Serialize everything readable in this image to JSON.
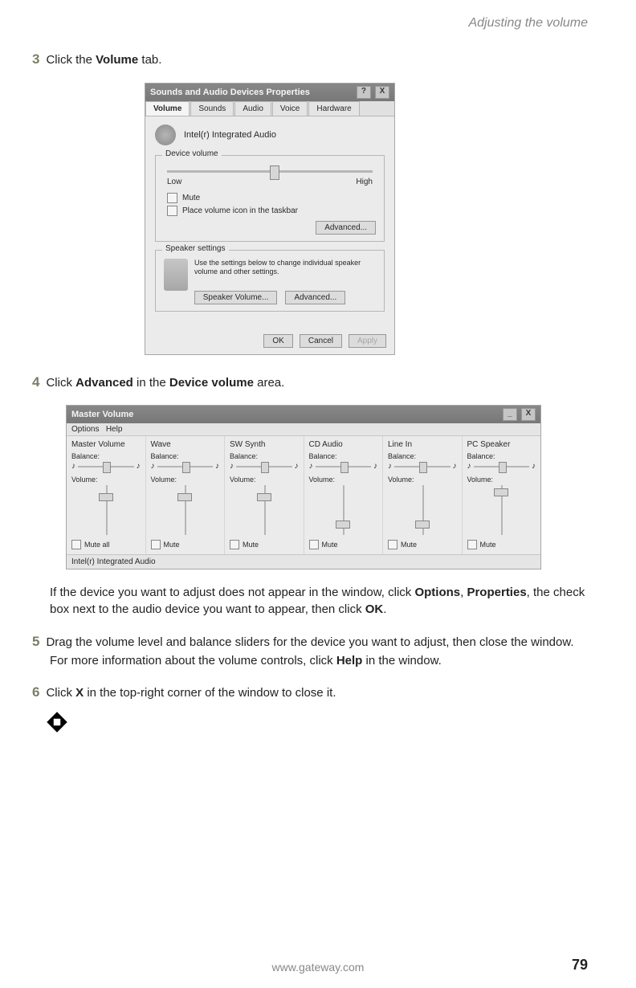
{
  "header": {
    "section_title": "Adjusting the volume"
  },
  "steps": {
    "s3": {
      "num": "3",
      "pre": "Click the ",
      "bold": "Volume",
      "post": " tab."
    },
    "s4": {
      "num": "4",
      "pre": "Click ",
      "bold1": "Advanced",
      "mid": " in the ",
      "bold2": "Device volume",
      "post": " area."
    },
    "s5": {
      "num": "5",
      "text_a": "Drag the volume level and balance sliders for the device you want to adjust, then close the window. For more information about the volume controls, click ",
      "bold": "Help",
      "text_b": " in the window."
    },
    "s6": {
      "num": "6",
      "text_a": "Click ",
      "bold": "X",
      "text_b": " in the top-right corner of the window to close it."
    }
  },
  "note_para": {
    "a": "If the device you want to adjust does not appear in the window, click ",
    "b1": "Options",
    "c": ", ",
    "b2": "Properties",
    "d": ", the check box next to the audio device you want to appear, then click ",
    "b3": "OK",
    "e": "."
  },
  "shot1": {
    "title": "Sounds and Audio Devices Properties",
    "help_btn": "?",
    "close_btn": "X",
    "tabs": {
      "t1": "Volume",
      "t2": "Sounds",
      "t3": "Audio",
      "t4": "Voice",
      "t5": "Hardware"
    },
    "device_name": "Intel(r) Integrated Audio",
    "group_device": "Device volume",
    "low": "Low",
    "high": "High",
    "mute": "Mute",
    "taskbar": "Place volume icon in the taskbar",
    "advanced_btn": "Advanced...",
    "group_speaker": "Speaker settings",
    "speaker_text": "Use the settings below to change individual speaker volume and other settings.",
    "spk_vol_btn": "Speaker Volume...",
    "spk_adv_btn": "Advanced...",
    "ok": "OK",
    "cancel": "Cancel",
    "apply": "Apply"
  },
  "shot2": {
    "title": "Master Volume",
    "min_btn": "_",
    "close_btn": "X",
    "menu": {
      "options": "Options",
      "help": "Help"
    },
    "cols": {
      "c1": "Master Volume",
      "c2": "Wave",
      "c3": "SW Synth",
      "c4": "CD Audio",
      "c5": "Line In",
      "c6": "PC Speaker"
    },
    "balance": "Balance:",
    "volume": "Volume:",
    "mute_all": "Mute all",
    "mute": "Mute",
    "vpos": {
      "c1": 10,
      "c2": 10,
      "c3": 10,
      "c4": 44,
      "c5": 44,
      "c6": 4
    },
    "status": "Intel(r) Integrated Audio"
  },
  "footer": {
    "url": "www.gateway.com",
    "page": "79"
  }
}
